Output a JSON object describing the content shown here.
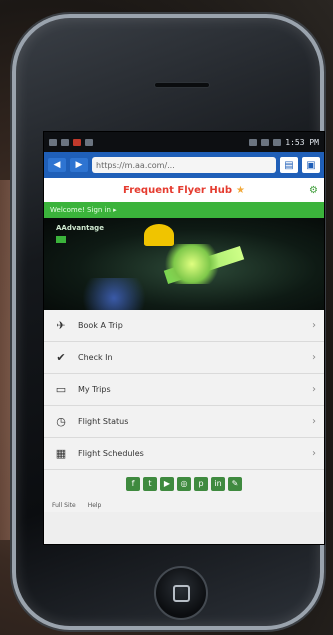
{
  "status_bar": {
    "time": "1:53 PM"
  },
  "browser": {
    "back_label": "◀",
    "forward_label": "▶",
    "url": "https://m.aa.com/..."
  },
  "promo": {
    "text": "Frequent Flyer Hub"
  },
  "green_bar": {
    "text": "Welcome! Sign in ▸"
  },
  "hero": {
    "label": "AAdvantage"
  },
  "menu": [
    {
      "label": "Book A Trip",
      "icon": "plane-icon"
    },
    {
      "label": "Check In",
      "icon": "check-icon"
    },
    {
      "label": "My Trips",
      "icon": "suitcase-icon"
    },
    {
      "label": "Flight Status",
      "icon": "clock-icon"
    },
    {
      "label": "Flight Schedules",
      "icon": "calendar-icon"
    }
  ],
  "footer": {
    "link1": "Full Site",
    "link2": "Help"
  },
  "colors": {
    "browser_bar": "#1f5fb8",
    "green_bar": "#3bb33b",
    "promo_text": "#e53b2f"
  }
}
